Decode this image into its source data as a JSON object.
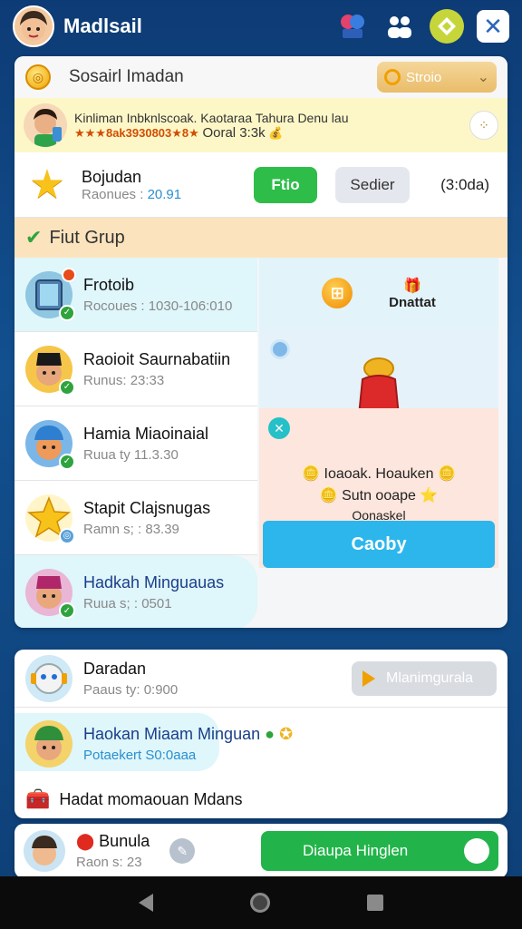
{
  "app": {
    "title": "Madlsail"
  },
  "search_row": {
    "label": "Sosairl Imadan",
    "dropdown_value": "Stroio"
  },
  "promo": {
    "title": "Kinliman Inbknlscoak. Kaotaraa Tahura Denu lau",
    "stars": "★★★8ak3930803★8★",
    "sub_dark": "Ooral 3:3k"
  },
  "user": {
    "name": "Bojudan",
    "rank_label": "Raonues :",
    "rank_value": "20.91",
    "primary_button": "Ftio",
    "secondary_button": "Sedier",
    "time": "(3:0da)"
  },
  "group": {
    "title": "Fiut Grup"
  },
  "list": [
    {
      "name": "Frotoib",
      "sub": "Rocoues : 1030-106:010"
    },
    {
      "name": "Raoioit Saurnabatiin",
      "sub": "Runus: 23:33"
    },
    {
      "name": "Hamia Miaoinaial",
      "sub": "Ruua ty 11.3.30"
    },
    {
      "name": "Stapit Clajsnugas",
      "sub": "Ramn s; : 83.39"
    },
    {
      "name": "Hadkah Minguauas",
      "sub": "Ruua s; : 0501"
    }
  ],
  "side": {
    "top_label": "Dnattat",
    "card_line1": "Ioaoak. Hoauken",
    "card_line2": "Sutn   ooape",
    "card_line3": "Oonaskel",
    "claim_button": "Caoby"
  },
  "panel2": {
    "row1_name": "Daradan",
    "row1_sub": "Paaus ty: 0:900",
    "play_button": "Mlanimgurala",
    "row2_name": "Haokan Miaam Minguan",
    "row2_sub": "Potaekert S0:0aaa",
    "row3_text": "Hadat momaouan Mdans"
  },
  "panel3": {
    "name": "Bunula",
    "sub": "Raon s: 23",
    "wide_button": "Diaupa Hinglen"
  },
  "colors": {
    "accent_green": "#2fbd4a",
    "accent_blue": "#2db6ec",
    "promo_bg": "#fdf7c8",
    "group_header_bg": "#fbe3bd"
  }
}
